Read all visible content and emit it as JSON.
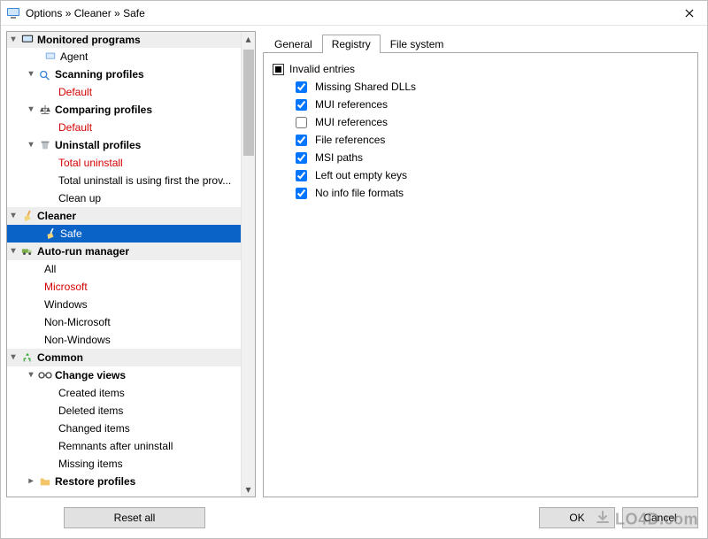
{
  "title": "Options » Cleaner » Safe",
  "tree": {
    "monitored_programs": "Monitored programs",
    "agent": "Agent",
    "scanning_profiles": "Scanning profiles",
    "scanning_default": "Default",
    "comparing_profiles": "Comparing profiles",
    "comparing_default": "Default",
    "uninstall_profiles": "Uninstall profiles",
    "total_uninstall": "Total uninstall",
    "total_uninstall_desc": "Total uninstall is using first the prov...",
    "clean_up": "Clean up",
    "cleaner": "Cleaner",
    "safe": "Safe",
    "auto_run": "Auto-run manager",
    "ar_all": "All",
    "ar_microsoft": "Microsoft",
    "ar_windows": "Windows",
    "ar_non_ms": "Non-Microsoft",
    "ar_non_win": "Non-Windows",
    "common": "Common",
    "change_views": "Change views",
    "cv_created": "Created items",
    "cv_deleted": "Deleted items",
    "cv_changed": "Changed items",
    "cv_remnants": "Remnants after uninstall",
    "cv_missing": "Missing items",
    "restore_profiles": "Restore profiles"
  },
  "tabs": {
    "general": "General",
    "registry": "Registry",
    "filesystem": "File system"
  },
  "registry": {
    "root": "Invalid entries",
    "items": [
      {
        "label": "Missing Shared DLLs",
        "checked": true
      },
      {
        "label": "MUI references",
        "checked": true
      },
      {
        "label": "MUI references",
        "checked": false
      },
      {
        "label": "File references",
        "checked": true
      },
      {
        "label": "MSI paths",
        "checked": true
      },
      {
        "label": "Left out empty keys",
        "checked": true
      },
      {
        "label": "No info file formats",
        "checked": true
      }
    ]
  },
  "buttons": {
    "reset": "Reset all",
    "ok": "OK",
    "cancel": "Cancel"
  },
  "watermark": "LO4D.com"
}
